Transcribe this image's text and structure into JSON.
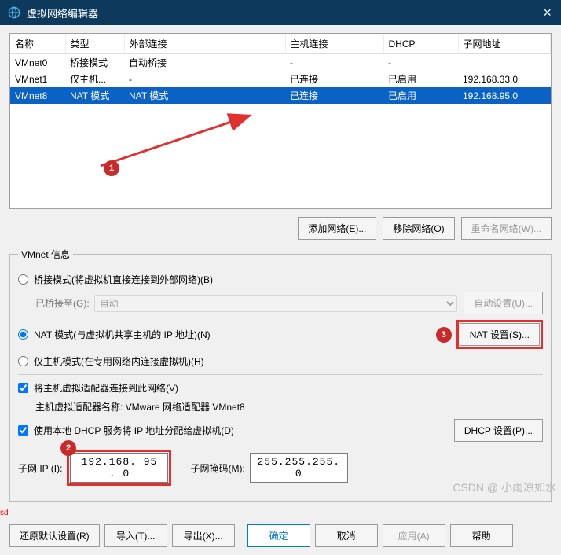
{
  "window": {
    "title": "虚拟网络编辑器"
  },
  "table": {
    "headers": [
      "名称",
      "类型",
      "外部连接",
      "主机连接",
      "DHCP",
      "子网地址"
    ],
    "rows": [
      {
        "name": "VMnet0",
        "type": "桥接模式",
        "ext": "自动桥接",
        "host": "-",
        "dhcp": "-",
        "subnet": ""
      },
      {
        "name": "VMnet1",
        "type": "仅主机...",
        "ext": "-",
        "host": "已连接",
        "dhcp": "已启用",
        "subnet": "192.168.33.0"
      },
      {
        "name": "VMnet8",
        "type": "NAT 模式",
        "ext": "NAT 模式",
        "host": "已连接",
        "dhcp": "已启用",
        "subnet": "192.168.95.0",
        "selected": true
      }
    ]
  },
  "buttons": {
    "add_network": "添加网络(E)...",
    "remove_network": "移除网络(O)",
    "rename_network": "重命名网络(W)...",
    "auto_bridge": "自动设置(U)...",
    "nat_settings": "NAT 设置(S)...",
    "dhcp_settings": "DHCP 设置(P)...",
    "restore_defaults": "还原默认设置(R)",
    "import": "导入(T)...",
    "export": "导出(X)...",
    "ok": "确定",
    "cancel": "取消",
    "apply": "应用(A)",
    "help": "帮助"
  },
  "vmnet_info": {
    "legend": "VMnet 信息",
    "bridge_radio": "桥接模式(将虚拟机直接连接到外部网络)(B)",
    "bridge_to_label": "已桥接至(G):",
    "bridge_to_value": "自动",
    "nat_radio": "NAT 模式(与虚拟机共享主机的 IP 地址)(N)",
    "hostonly_radio": "仅主机模式(在专用网络内连接虚拟机)(H)",
    "connect_host_cb": "将主机虚拟适配器连接到此网络(V)",
    "host_adapter_label": "主机虚拟适配器名称: VMware 网络适配器 VMnet8",
    "dhcp_cb": "使用本地 DHCP 服务将 IP 地址分配给虚拟机(D)",
    "subnet_ip_label": "子网 IP (I):",
    "subnet_ip_value": "192.168. 95 .  0",
    "subnet_mask_label": "子网掩码(M):",
    "subnet_mask_value": "255.255.255.  0"
  },
  "annotations": {
    "badge1": "1",
    "badge2": "2",
    "badge3": "3"
  },
  "watermark": "CSDN @ 小雨凉如水",
  "sd": "sd"
}
